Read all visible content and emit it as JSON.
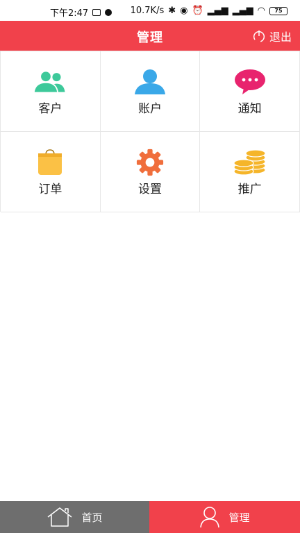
{
  "status_bar": {
    "time": "下午2:47",
    "speed": "10.7K/s",
    "battery": "75"
  },
  "header": {
    "title": "管理",
    "logout_label": "退出"
  },
  "grid": [
    {
      "label": "客户",
      "icon": "customers-icon",
      "color": "#3dc99a"
    },
    {
      "label": "账户",
      "icon": "account-icon",
      "color": "#3aa8e8"
    },
    {
      "label": "通知",
      "icon": "message-icon",
      "color": "#e8246e"
    },
    {
      "label": "订单",
      "icon": "order-bag-icon",
      "color": "#fbc145"
    },
    {
      "label": "设置",
      "icon": "gear-icon",
      "color": "#f06e3c"
    },
    {
      "label": "推广",
      "icon": "coins-icon",
      "color": "#f5b52a"
    }
  ],
  "tabbar": {
    "home_label": "首页",
    "manage_label": "管理"
  },
  "colors": {
    "brand_red": "#f1414b",
    "tab_inactive": "#6e6e6e"
  }
}
